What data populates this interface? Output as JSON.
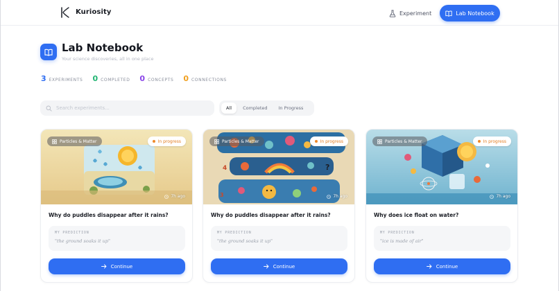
{
  "brand": {
    "name": "Kuriosity"
  },
  "nav": {
    "experiment_label": "Experiment",
    "lab_notebook_label": "Lab Notebook"
  },
  "page": {
    "title": "Lab Notebook",
    "subtitle": "Your science discoveries, all in one place"
  },
  "stats": [
    {
      "value": "3",
      "label": "Experiments",
      "color": "#2f6ef2"
    },
    {
      "value": "0",
      "label": "Completed",
      "color": "#22b573"
    },
    {
      "value": "0",
      "label": "Concepts",
      "color": "#8b46e8"
    },
    {
      "value": "0",
      "label": "Connections",
      "color": "#f0a020"
    }
  ],
  "search": {
    "placeholder": "Search experiments..."
  },
  "filters": [
    "All",
    "Completed",
    "In Progress"
  ],
  "cards": [
    {
      "topic": "Particles & Matter",
      "status": "In progress",
      "time": "7h ago",
      "question": "Why do puddles disappear after it rains?",
      "prediction_label": "My prediction",
      "prediction": "\"the ground soaks it up\"",
      "action": "Continue"
    },
    {
      "topic": "Particles & Matter",
      "status": "In progress",
      "time": "7h ago",
      "question": "Why do puddles disappear after it rains?",
      "prediction_label": "My prediction",
      "prediction": "\"the ground soaks it up\"",
      "action": "Continue"
    },
    {
      "topic": "Particles & Matter",
      "status": "In progress",
      "time": "7h ago",
      "question": "Why does ice float on water?",
      "prediction_label": "My prediction",
      "prediction": "\"ice is made of air\"",
      "action": "Continue"
    }
  ],
  "colors": {
    "accent": "#2f6ef2",
    "status": "#e27b1f"
  }
}
